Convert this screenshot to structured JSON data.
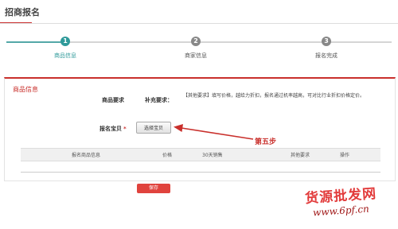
{
  "page": {
    "title": "招商报名"
  },
  "steps": [
    {
      "number": "1",
      "label": "商品信息",
      "active": true
    },
    {
      "number": "2",
      "label": "商家信息",
      "active": false
    },
    {
      "number": "3",
      "label": "报名完成",
      "active": false
    }
  ],
  "panel": {
    "title": "商品信息",
    "requirements_label": "商品要求",
    "extra_label": "补充要求：",
    "extra_text": "【其他要求】填写价格，越给力折扣，报名通过机率越高，可对比行业折扣价格定价。"
  },
  "register": {
    "label": "报名宝贝",
    "required_mark": "*",
    "select_button": "选择宝贝"
  },
  "annotation": {
    "step_note": "第五步"
  },
  "table": {
    "headers": [
      "报名商品信息",
      "价格",
      "30天销售",
      "其他要求",
      "操作"
    ]
  },
  "actions": {
    "save": "保存"
  },
  "watermark": {
    "line1": "货源批发网",
    "line2": "www.6pf.cn"
  },
  "colors": {
    "accent": "#c9302c",
    "step_active": "#2f9a9a"
  }
}
